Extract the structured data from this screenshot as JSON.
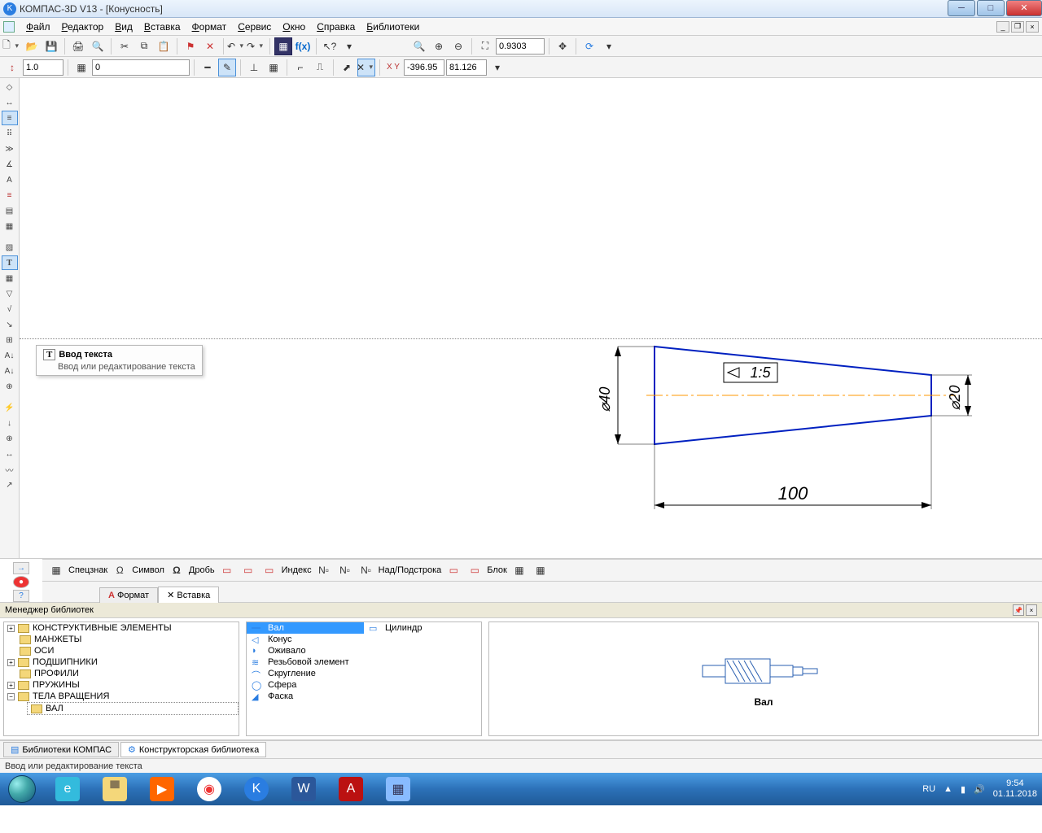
{
  "title": "КОМПАС-3D V13 - [Конусность]",
  "menu": [
    "Файл",
    "Редактор",
    "Вид",
    "Вставка",
    "Формат",
    "Сервис",
    "Окно",
    "Справка",
    "Библиотеки"
  ],
  "toolbar2": {
    "scale": "1.0",
    "layer": "0",
    "coord_x": "-396.95",
    "coord_y": "81.126",
    "zoom": "0.9303"
  },
  "tooltip": {
    "title": "Ввод текста",
    "desc": "Ввод или редактирование текста"
  },
  "drawing": {
    "dim_left": "⌀40",
    "dim_right": "⌀20",
    "dim_bottom": "100",
    "taper_label": "1:5"
  },
  "bottom_panel": {
    "buttons": [
      "Спецзнак",
      "Символ",
      "Дробь",
      "Индекс",
      "Над/Подстрока",
      "Блок"
    ],
    "tabs": [
      "Формат",
      "Вставка"
    ],
    "active_tab": "Вставка"
  },
  "libmgr": {
    "title": "Менеджер библиотек",
    "tree": [
      {
        "label": "КОНСТРУКТИВНЫЕ ЭЛЕМЕНТЫ",
        "expandable": true
      },
      {
        "label": "МАНЖЕТЫ",
        "expandable": false
      },
      {
        "label": "ОСИ",
        "expandable": false
      },
      {
        "label": "ПОДШИПНИКИ",
        "expandable": true
      },
      {
        "label": "ПРОФИЛИ",
        "expandable": false
      },
      {
        "label": "ПРУЖИНЫ",
        "expandable": true
      },
      {
        "label": "ТЕЛА ВРАЩЕНИЯ",
        "expandable": true,
        "open": true
      },
      {
        "label": "ВАЛ",
        "child": true,
        "selected": true
      }
    ],
    "list_left": [
      "Вал",
      "Конус",
      "Оживало",
      "Резьбовой элемент",
      "Скругление",
      "Сфера",
      "Фаска"
    ],
    "list_right": [
      "Цилиндр"
    ],
    "preview_label": "Вал",
    "bottom_tabs": [
      "Библиотеки КОМПАС",
      "Конструкторская библиотека"
    ]
  },
  "statusbar": "Ввод или редактирование текста",
  "tray": {
    "lang": "RU",
    "time": "9:54",
    "date": "01.11.2018"
  }
}
